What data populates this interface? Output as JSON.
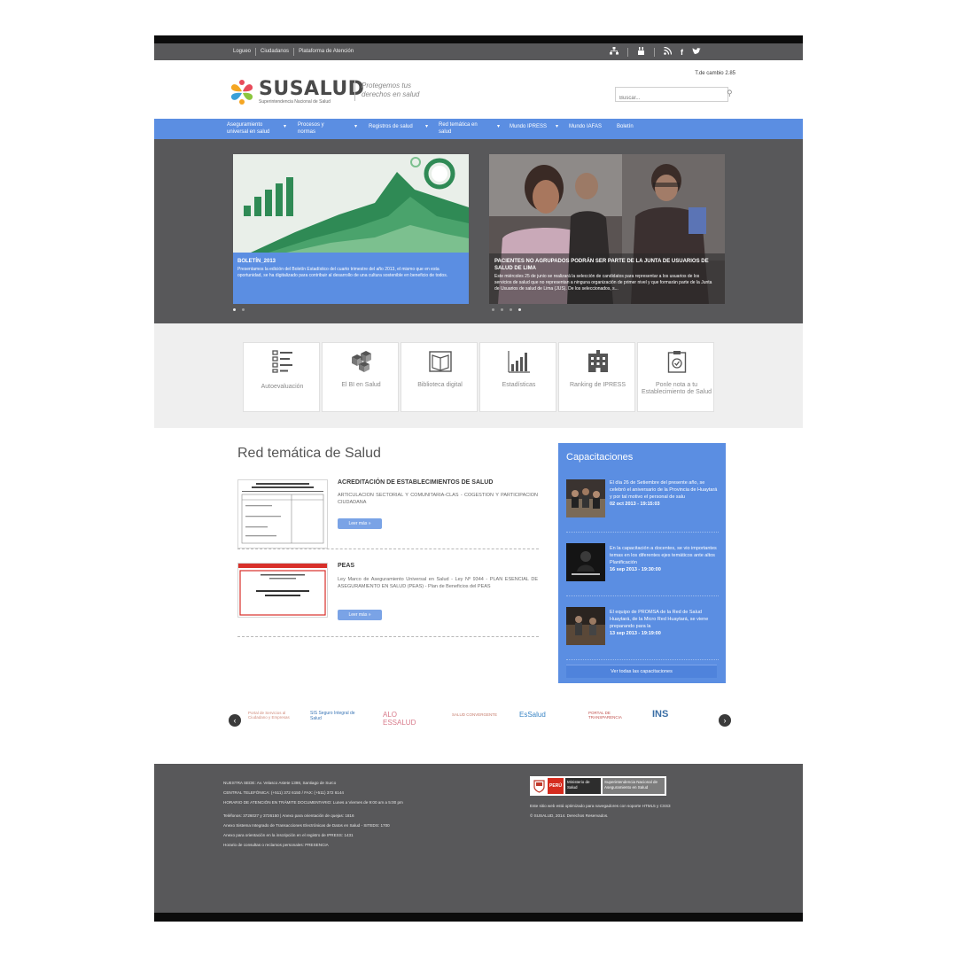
{
  "topbar": {
    "links": [
      "Logueo",
      "Ciudadanos",
      "Plataforma de Atención"
    ],
    "social_icons": [
      "sitemap-icon",
      "youtube-icon",
      "rss-icon",
      "facebook-icon",
      "twitter-icon"
    ]
  },
  "header": {
    "brand": "SUSALUD",
    "brand_sub": "Superintendencia Nacional de Salud",
    "tagline": "Protegemos tus derechos en salud",
    "exchange_rate": "T.de cambio 2.85",
    "search_placeholder": "Buscar..."
  },
  "nav": {
    "items": [
      "Aseguramiento universal en salud",
      "Procesos y normas",
      "Registros de salud",
      "Red temática en salud",
      "Mundo IPRESS",
      "Mundo IAFAS",
      "Boletín"
    ]
  },
  "hero": {
    "slide1": {
      "title": "BOLETÍN_2013",
      "text": "Presentamos la edición del Boletín Estadístico del cuarto trimestre del año 2013, el mismo que en esta oportunidad, se ha digitalizado para contribuir al desarrollo de una cultura sostenible en beneficio de todos."
    },
    "slide2": {
      "title": "PACIENTES NO AGRUPADOS PODRÁN SER PARTE DE LA JUNTA DE USUARIOS DE SALUD DE LIMA",
      "text": "Este miércoles 25 de junio se realizará la selección de candidatos para representar a los usuarios de los servicios de salud que no representan a ninguna organización de primer nivel y que formarán parte de la Junta de Usuarios de salud de Lima (JUS). De los seleccionados, s..."
    }
  },
  "quick_links": [
    {
      "label": "Autoevaluación",
      "icon": "checklist-icon"
    },
    {
      "label": "El BI en Salud",
      "icon": "cubes-icon"
    },
    {
      "label": "Biblioteca digital",
      "icon": "book-icon"
    },
    {
      "label": "Estadísticas",
      "icon": "bar-chart-icon"
    },
    {
      "label": "Ranking de IPRESS",
      "icon": "hospital-icon"
    },
    {
      "label": "Ponle nota a tu Establecimiento de Salud",
      "icon": "clipboard-icon"
    }
  ],
  "red_tematica": {
    "title": "Red temática de Salud",
    "articles": [
      {
        "title": "ACREDITACIÓN DE ESTABLECIMIENTOS DE SALUD",
        "text": "ARTICULACION SECTORIAL Y COMUNITARIA-CLAS - COGESTION Y PARTICIPACION CIUDADANA",
        "button": "Leer más »"
      },
      {
        "title": "PEAS",
        "text": "Ley Marco de Aseguramiento Universal en Salud - Ley Nº 9344 - PLAN ESENCIAL DE ASEGURAMIENTO EN SALUD (PEAS) - Plan de Beneficios del PEAS",
        "button": "Leer más »"
      }
    ]
  },
  "capacitaciones": {
    "title": "Capacitaciones",
    "items": [
      {
        "text": "El día 26 de Setiembre del presente año, se celebró el aniversario de la Provincia de Huaytará y por tal motivo el personal de salu",
        "date": "02 oct 2013 - 19:15:03"
      },
      {
        "text": "En la capacitación a docentes, se vio importantes temas en los diferentes ejes temáticos ante altos Planificación",
        "date": "16 sep 2013 - 19:30:00"
      },
      {
        "text": "El equipo de PROMSA de la Red de Salud Huaytará, de la Micro Red Huaytará, se viene preparando para la",
        "date": "13 sep 2013 - 19:19:00"
      }
    ],
    "button": "Ver todas las capacitaciones"
  },
  "partners": [
    "Portal de Servicios al Ciudadano y Empresas",
    "SIS Seguro Integral de Salud",
    "ALO ESSALUD",
    "SALUD CONVERGENTE",
    "EsSalud",
    "PORTAL DE TRANSPARENCIA",
    "INS"
  ],
  "footer": {
    "lines": [
      "NUESTRA SEDE: Av. Velasco Astete 1398, Santiago de Surco",
      "CENTRAL TELEFÓNICA: (+511) 372 6150 / FAX: (+511) 372 6144",
      "HORARIO DE ATENCIÓN EN TRÁMITE DOCUMENTARIO: Lunes a Viernes de 9:00 am a 5:00 pm",
      "Teléfonos: 3726027 y 3726150  |  Anexo para orientación de quejas: 1816",
      "Anexo Sistema Integrado de Transacciones Electrónicas de Datos en Salud - SITEDS: 1700",
      "Anexo para orientación en la inscripción en el registro de IPRESS: 1431",
      "Horario de consultas o reclamos personales: PRESENCIA"
    ],
    "gov_peru": "PERÚ",
    "gov_ministerio": "Ministerio de Salud",
    "gov_entity": "Superintendencia Nacional de Aseguramiento en Salud",
    "note": "Este sitio web está optimizado para navegadores con soporte HTML5 y CSS3",
    "copyright": "© SUSALUD, 2014. Derechos Reservados."
  }
}
